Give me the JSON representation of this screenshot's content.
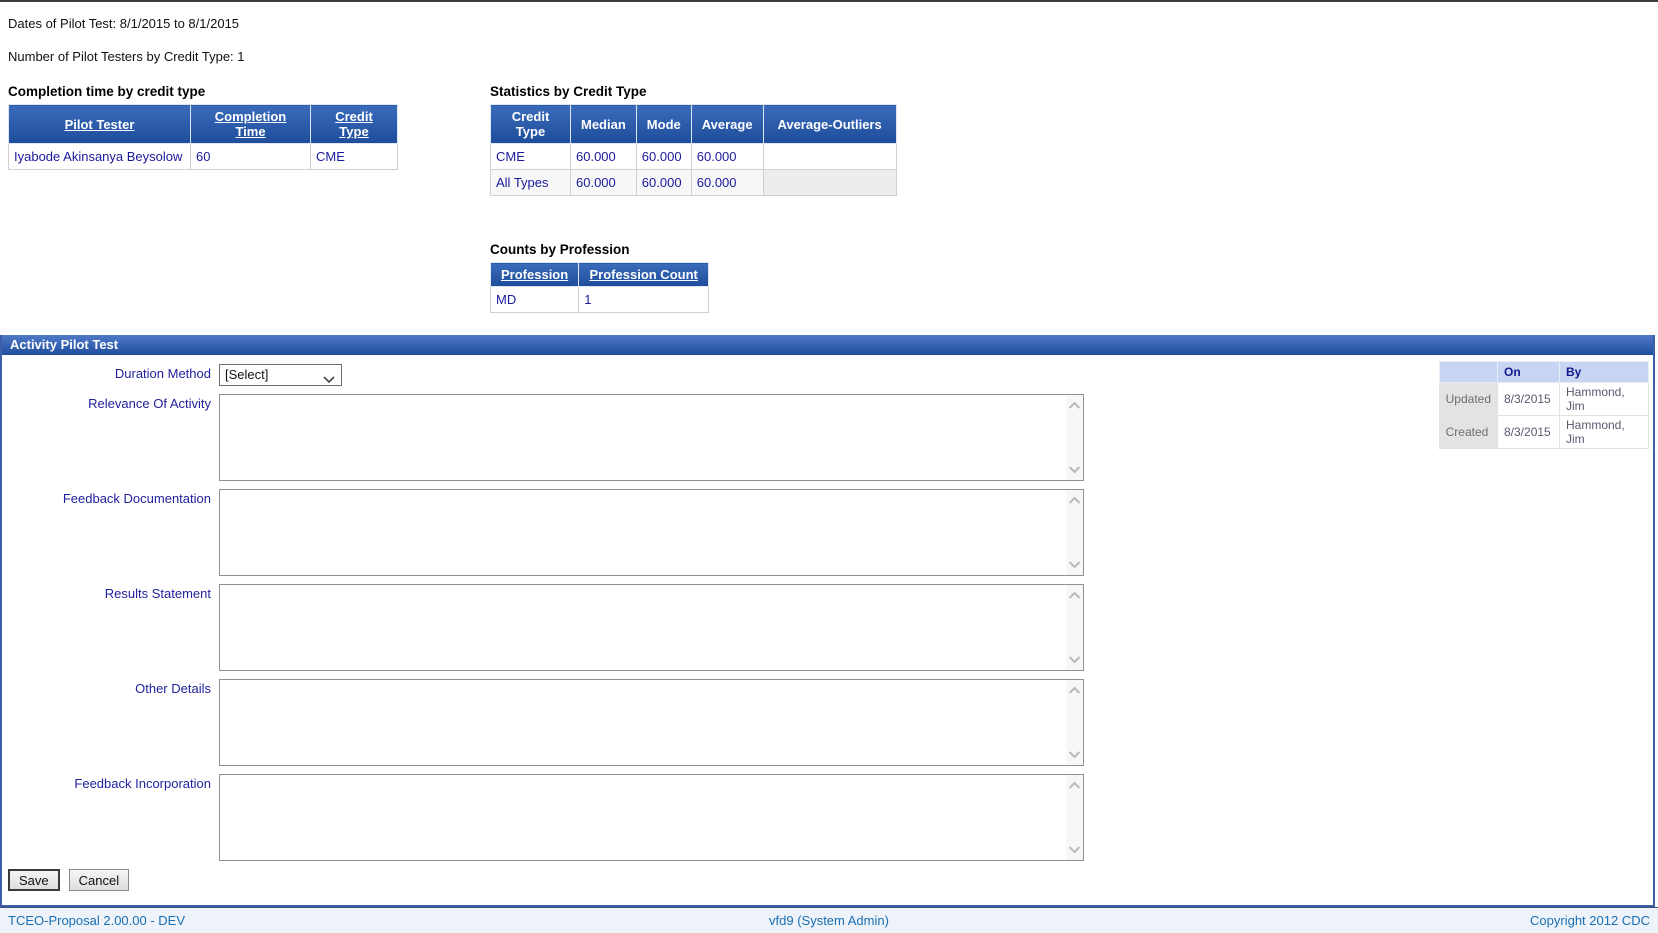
{
  "intro": {
    "dates_line": "Dates of Pilot Test: 8/1/2015 to 8/1/2015",
    "testers_line": "Number of Pilot Testers by Credit Type: 1"
  },
  "completion_table": {
    "title": "Completion time by credit type",
    "columns": [
      "Pilot Tester",
      "Completion Time",
      "Credit Type"
    ],
    "rows": [
      [
        "Iyabode Akinsanya Beysolow",
        "60",
        "CME"
      ]
    ]
  },
  "statistics_table": {
    "title": "Statistics by Credit Type",
    "columns": [
      "Credit Type",
      "Median",
      "Mode",
      "Average",
      "Average-Outliers"
    ],
    "rows": [
      [
        "CME",
        "60.000",
        "60.000",
        "60.000",
        ""
      ],
      [
        "All Types",
        "60.000",
        "60.000",
        "60.000",
        ""
      ]
    ]
  },
  "counts_table": {
    "title": "Counts by Profession",
    "columns": [
      "Profession",
      "Profession Count"
    ],
    "rows": [
      [
        "MD",
        "1"
      ]
    ]
  },
  "pilot_section": {
    "title": "Activity Pilot Test",
    "duration_label": "Duration Method",
    "duration_value": "[Select]",
    "fields": [
      {
        "label": "Relevance Of Activity",
        "value": ""
      },
      {
        "label": "Feedback Documentation",
        "value": ""
      },
      {
        "label": "Results Statement",
        "value": ""
      },
      {
        "label": "Other Details",
        "value": ""
      },
      {
        "label": "Feedback Incorporation",
        "value": ""
      }
    ],
    "audit": {
      "columns": [
        "",
        "On",
        "By"
      ],
      "rows": [
        [
          "Updated",
          "8/3/2015",
          "Hammond, Jim"
        ],
        [
          "Created",
          "8/3/2015",
          "Hammond, Jim"
        ]
      ]
    },
    "save_label": "Save",
    "cancel_label": "Cancel"
  },
  "footer": {
    "left": "TCEO-Proposal 2.00.00 - DEV",
    "center": "vfd9 (System Admin)",
    "right": "Copyright 2012 CDC"
  },
  "colors": {
    "header_blue": "#1e4c9a",
    "banner_blue": "#2a57ab",
    "navy_text": "#1a1a9e",
    "footer_text": "#1a70b4",
    "footer_bg": "#eef2f9"
  }
}
